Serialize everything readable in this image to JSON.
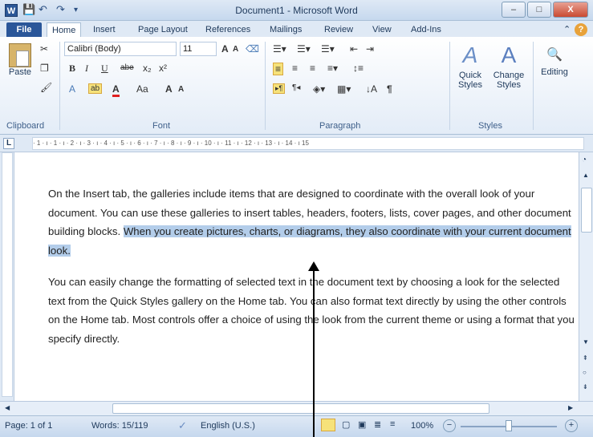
{
  "window": {
    "app_icon": "W",
    "title": "Document1 - Microsoft Word",
    "minimize": "–",
    "maximize": "□",
    "close": "X"
  },
  "quick_access": {
    "save": "💾",
    "undo": "↶",
    "redo": "↷",
    "customize": "▾"
  },
  "tabs": [
    "File",
    "Home",
    "Insert",
    "Page Layout",
    "References",
    "Mailings",
    "Review",
    "View",
    "Add-Ins"
  ],
  "ribbon": {
    "clipboard": {
      "paste": "Paste",
      "label": "Clipboard"
    },
    "font": {
      "name": "Calibri (Body)",
      "size": "11",
      "label": "Font",
      "bold": "B",
      "italic": "I",
      "underline": "U",
      "strike": "abe",
      "sub": "x₂",
      "sup": "x²",
      "grow": "A",
      "shrink": "A",
      "case": "Aa",
      "clear": "A"
    },
    "paragraph": {
      "label": "Paragraph"
    },
    "styles": {
      "quick": "Quick Styles",
      "change": "Change Styles",
      "label": "Styles"
    },
    "editing": {
      "label": "Editing"
    }
  },
  "ruler_text": "· 1 · ı · 1 · ı · 2 · ı · 3 · ı · 4 · ı · 5 · ı · 6 · ı · 7 · ı · 8 · ı · 9 · ı · 10 · ı · 11 · ı · 12 · ı · 13 · ı · 14 · ı 15",
  "document": {
    "para1_normal": "On the Insert tab, the galleries include items that are designed to coordinate with the overall look of your document. You can use these galleries to insert tables, headers, footers, lists, cover pages, and other document building blocks. ",
    "para1_selected": "When you create pictures, charts, or diagrams, they also coordinate with your current document look.",
    "para2": "You can easily change the formatting of selected text in the document text by choosing a look for the selected text from the Quick Styles gallery on the Home tab. You can also format text directly by using the other controls on the Home tab. Most controls offer a choice of using the look from the current theme or using a format that you specify directly."
  },
  "status": {
    "page": "Page: 1 of 1",
    "words": "Words: 15/119",
    "language": "English (U.S.)",
    "zoom": "100%"
  }
}
